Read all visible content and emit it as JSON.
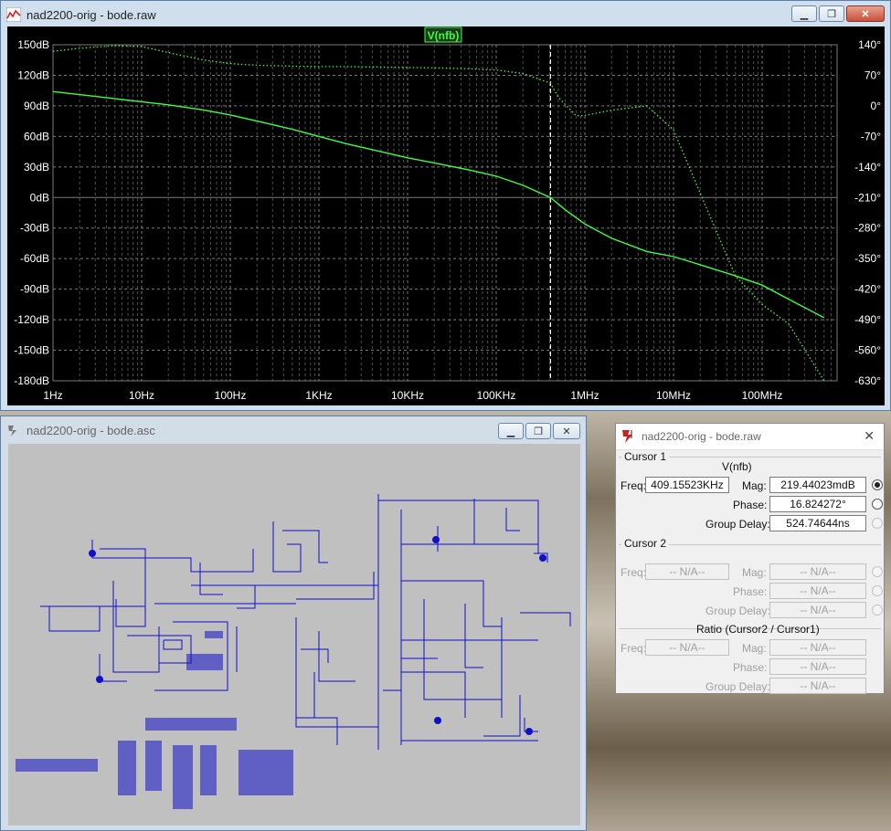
{
  "desktop": {},
  "plot_window": {
    "title": "nad2200-orig - bode.raw",
    "trace_label": "V(nfb)",
    "left_axis_ticks": [
      "150dB",
      "120dB",
      "90dB",
      "60dB",
      "30dB",
      "0dB",
      "-30dB",
      "-60dB",
      "-90dB",
      "-120dB",
      "-150dB",
      "-180dB"
    ],
    "right_axis_ticks": [
      "140°",
      "70°",
      "0°",
      "-70°",
      "-140°",
      "-210°",
      "-280°",
      "-350°",
      "-420°",
      "-490°",
      "-560°",
      "-630°"
    ],
    "x_axis_ticks": [
      "1Hz",
      "10Hz",
      "100Hz",
      "1KHz",
      "10KHz",
      "100KHz",
      "1MHz",
      "10MHz",
      "100MHz"
    ],
    "colors": {
      "background": "#000000",
      "trace": "#3cff3c",
      "grid": "#7a7a7a",
      "axis_text": "#ffffff"
    }
  },
  "chart_data": {
    "type": "line",
    "title": "V(nfb)",
    "xscale": "log",
    "x_unit": "Hz",
    "xlim": [
      1,
      700000000
    ],
    "ylim_left_db": [
      -180,
      150
    ],
    "ylim_right_deg": [
      -630,
      140
    ],
    "grid": true,
    "cursor_frequency_hz": 409155.23,
    "series": [
      {
        "name": "V(nfb)",
        "style": "solid",
        "axis": "left",
        "x": [
          1,
          2,
          5,
          10,
          20,
          50,
          100,
          200,
          500,
          1000,
          2000,
          5000,
          10000,
          20000,
          50000,
          100000,
          200000,
          409155,
          600000,
          1000000,
          2000000,
          5000000,
          10000000,
          20000000,
          50000000,
          100000000,
          200000000,
          500000000
        ],
        "y": [
          104,
          101,
          97,
          94,
          91,
          86,
          81,
          75,
          67,
          60,
          53,
          45,
          39,
          34,
          27,
          21,
          12,
          0,
          -12,
          -26,
          -40,
          -53,
          -58,
          -66,
          -77,
          -86,
          -100,
          -118
        ]
      },
      {
        "name": "V(nfb)",
        "style": "dotted",
        "axis": "right",
        "x": [
          1,
          2,
          5,
          10,
          20,
          50,
          100,
          200,
          500,
          1000,
          2000,
          5000,
          10000,
          20000,
          50000,
          100000,
          200000,
          409155,
          500000,
          800000,
          1000000,
          2000000,
          5000000,
          10000000,
          20000000,
          50000000,
          100000000,
          200000000,
          500000000
        ],
        "y": [
          125,
          132,
          138,
          136,
          122,
          105,
          97,
          93,
          91,
          90,
          90,
          89,
          88,
          87,
          85,
          82,
          74,
          52,
          20,
          -23,
          -22,
          -10,
          0,
          -55,
          -200,
          -390,
          -455,
          -500,
          -630
        ]
      }
    ]
  },
  "schematic_window": {
    "title": "nad2200-orig - bode.asc"
  },
  "cursor_window": {
    "title": "nad2200-orig - bode.raw",
    "close_label": "✕",
    "cursor1": {
      "label": "Cursor 1",
      "trace": "V(nfb)",
      "freq_label": "Freq:",
      "freq_value": "409.15523KHz",
      "mag_label": "Mag:",
      "mag_value": "219.44023mdB",
      "phase_label": "Phase:",
      "phase_value": "16.824272°",
      "gd_label": "Group Delay:",
      "gd_value": "524.74644ns"
    },
    "cursor2": {
      "label": "Cursor 2",
      "freq_label": "Freq:",
      "freq_value": "-- N/A--",
      "mag_label": "Mag:",
      "mag_value": "-- N/A--",
      "phase_label": "Phase:",
      "phase_value": "-- N/A--",
      "gd_label": "Group Delay:",
      "gd_value": "-- N/A--"
    },
    "ratio": {
      "label": "Ratio (Cursor2 / Cursor1)",
      "freq_label": "Freq:",
      "freq_value": "-- N/A--",
      "mag_label": "Mag:",
      "mag_value": "-- N/A--",
      "phase_label": "Phase:",
      "phase_value": "-- N/A--",
      "gd_label": "Group Delay:",
      "gd_value": "-- N/A--"
    }
  }
}
